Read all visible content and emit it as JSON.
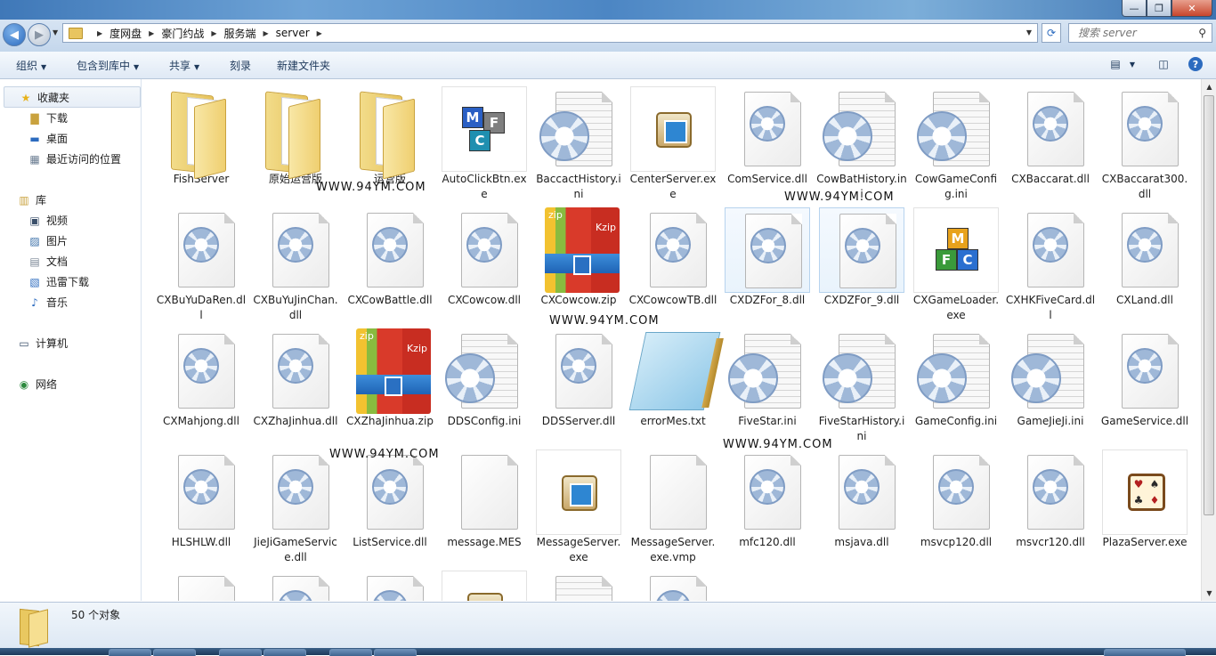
{
  "window": {
    "minimize": "—",
    "maximize": "❐",
    "close": "✕"
  },
  "address": {
    "crumbs": [
      "度网盘",
      "豪门约战",
      "服务端",
      "server"
    ],
    "search_placeholder": "搜索 server"
  },
  "toolbar": {
    "organize": "组织",
    "include_library": "包含到库中",
    "share": "共享",
    "burn": "刻录",
    "new_folder": "新建文件夹",
    "help": "?"
  },
  "sidebar": {
    "favorites": "收藏夹",
    "downloads": "下载",
    "desktop": "桌面",
    "recent": "最近访问的位置",
    "libraries": "库",
    "videos": "视频",
    "pictures": "图片",
    "documents": "文档",
    "thunder": "迅雷下载",
    "music": "音乐",
    "computer": "计算机",
    "network": "网络"
  },
  "files": [
    {
      "name": "FishServer",
      "icon": "folder-icon"
    },
    {
      "name": "原始运营版",
      "icon": "folder-icon"
    },
    {
      "name": "运营版",
      "icon": "folder-icon"
    },
    {
      "name": "AutoClickBtn.exe",
      "icon": "mfc-app-icon"
    },
    {
      "name": "BaccactHistory.ini",
      "icon": "config-file-icon"
    },
    {
      "name": "CenterServer.exe",
      "icon": "server-app-icon"
    },
    {
      "name": "ComService.dll",
      "icon": "dll-file-icon"
    },
    {
      "name": "CowBatHistory.ini",
      "icon": "config-file-icon"
    },
    {
      "name": "CowGameConfig.ini",
      "icon": "config-file-icon"
    },
    {
      "name": "CXBaccarat.dll",
      "icon": "dll-file-icon"
    },
    {
      "name": "CXBaccarat300.dll",
      "icon": "dll-file-icon"
    },
    {
      "name": "CXBuYuDaRen.dll",
      "icon": "dll-file-icon"
    },
    {
      "name": "CXBuYuJinChan.dll",
      "icon": "dll-file-icon"
    },
    {
      "name": "CXCowBattle.dll",
      "icon": "dll-file-icon"
    },
    {
      "name": "CXCowcow.dll",
      "icon": "dll-file-icon"
    },
    {
      "name": "CXCowcow.zip",
      "icon": "zip-archive-icon"
    },
    {
      "name": "CXCowcowTB.dll",
      "icon": "dll-file-icon"
    },
    {
      "name": "CXDZFor_8.dll",
      "icon": "dll-file-icon"
    },
    {
      "name": "CXDZFor_9.dll",
      "icon": "dll-file-icon"
    },
    {
      "name": "CXGameLoader.exe",
      "icon": "mfc-loader-icon"
    },
    {
      "name": "CXHKFiveCard.dll",
      "icon": "dll-file-icon"
    },
    {
      "name": "CXLand.dll",
      "icon": "dll-file-icon"
    },
    {
      "name": "CXMahjong.dll",
      "icon": "dll-file-icon"
    },
    {
      "name": "CXZhaJinhua.dll",
      "icon": "dll-file-icon"
    },
    {
      "name": "CXZhaJinhua.zip",
      "icon": "zip-archive-icon"
    },
    {
      "name": "DDSConfig.ini",
      "icon": "config-file-icon"
    },
    {
      "name": "DDSServer.dll",
      "icon": "dll-file-icon"
    },
    {
      "name": "errorMes.txt",
      "icon": "notepad-icon"
    },
    {
      "name": "FiveStar.ini",
      "icon": "config-file-icon"
    },
    {
      "name": "FiveStarHistory.ini",
      "icon": "config-file-icon"
    },
    {
      "name": "GameConfig.ini",
      "icon": "config-file-icon"
    },
    {
      "name": "GameJieJi.ini",
      "icon": "config-file-icon"
    },
    {
      "name": "GameService.dll",
      "icon": "dll-file-icon"
    },
    {
      "name": "HLSHLW.dll",
      "icon": "dll-file-icon"
    },
    {
      "name": "JieJiGameService.dll",
      "icon": "dll-file-icon"
    },
    {
      "name": "ListService.dll",
      "icon": "dll-file-icon"
    },
    {
      "name": "message.MES",
      "icon": "blank-file-icon"
    },
    {
      "name": "MessageServer.exe",
      "icon": "server-app-icon"
    },
    {
      "name": "MessageServer.exe.vmp",
      "icon": "blank-file-icon"
    },
    {
      "name": "mfc120.dll",
      "icon": "dll-file-icon"
    },
    {
      "name": "msjava.dll",
      "icon": "dll-file-icon"
    },
    {
      "name": "msvcp120.dll",
      "icon": "dll-file-icon"
    },
    {
      "name": "msvcr120.dll",
      "icon": "dll-file-icon"
    },
    {
      "name": "PlazaServer.exe",
      "icon": "plaza-app-icon"
    }
  ],
  "watermark": "WWW.94YM.COM",
  "status": {
    "count": "50 个对象"
  },
  "colors": {
    "accent": "#2c6bbf",
    "folder": "#e8c560"
  }
}
